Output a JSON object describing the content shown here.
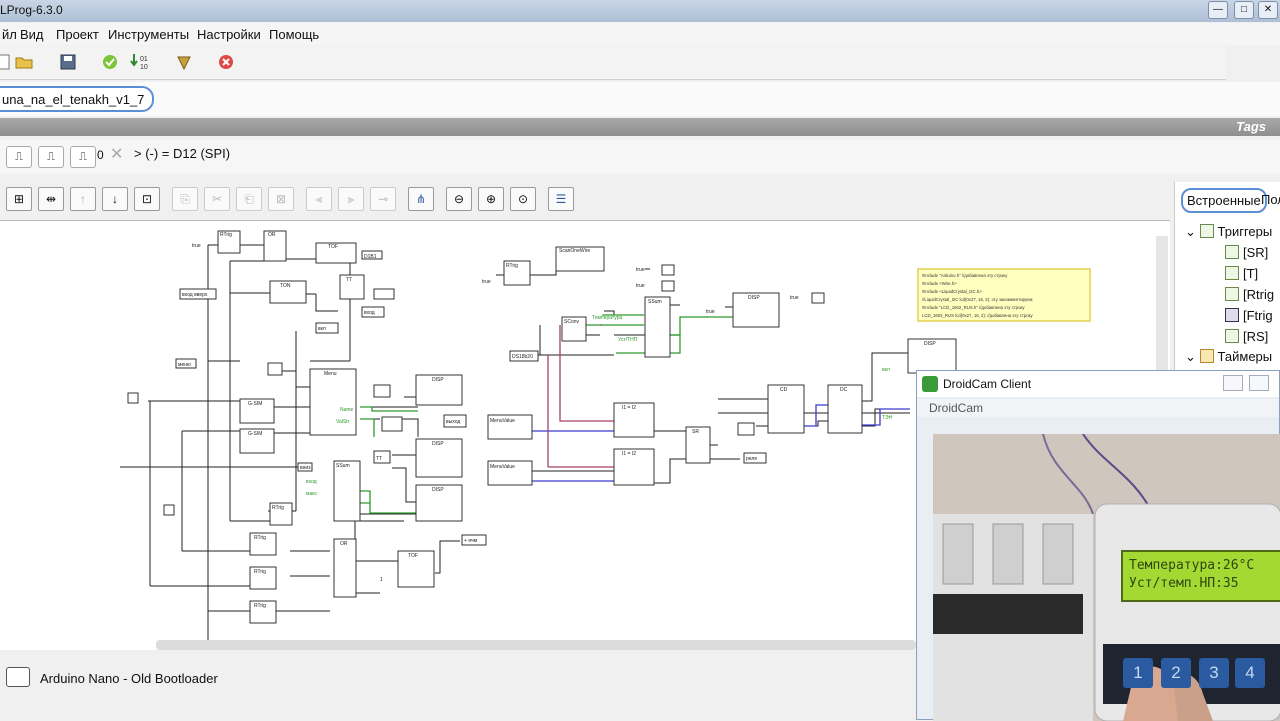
{
  "window": {
    "title": "LProg-6.3.0",
    "controls": [
      "—",
      "□",
      "✕"
    ]
  },
  "menu": [
    "йл",
    "Вид",
    "Проект",
    "Инструменты",
    "Настройки",
    "Помощь"
  ],
  "project_tab": "una_na_el_tenakh_v1_7",
  "tags_label": "Tags",
  "formula": {
    "prefix": "0",
    "text": "> (-) = D12 (SPI)"
  },
  "status_bar": {
    "board": "Arduino Nano - Old Bootloader"
  },
  "right_panel": {
    "tab_builtin": "Встроенные",
    "tab_other": "Пол",
    "tree": [
      {
        "label": "Триггеры",
        "group": true
      },
      {
        "label": "[SR]"
      },
      {
        "label": "[T]"
      },
      {
        "label": "[Rtrig"
      },
      {
        "label": "[Ftrig"
      },
      {
        "label": "[RS]"
      },
      {
        "label": "Таймеры",
        "group": true
      }
    ]
  },
  "diagram": {
    "blocks": {
      "rtrig1": "RTrig",
      "or1": "OR",
      "tof1": "TOF",
      "tt1": "TT",
      "ton": "TON",
      "menu": "Menu",
      "gsim1": "G-SIM",
      "gsim2": "G-SIM",
      "ssum1": "SSum",
      "disp1": "DISP",
      "disp2": "DISP",
      "disp3": "DISP",
      "tt2": "TT",
      "rtrig2": "RTrig",
      "rtrig3": "RTrig",
      "rtrig4": "RTrig",
      "rtrig5": "RTrig",
      "or2": "OR",
      "tof2": "TOF",
      "scan": "ScanOneWire",
      "rtrig6": "RTrig",
      "sconv": "SConv",
      "ssum2": "SSum",
      "disp4": "DISP",
      "i1": "I1 = I2",
      "i2": "I1 = I2",
      "sr": "SR",
      "cd": "CD",
      "dc": "DC",
      "disp5": "DISP",
      "mv1": "MenuValue",
      "mv2": "MenuValue"
    },
    "labels": {
      "true": "true",
      "d1": "D1B1",
      "vhod": "вход",
      "vkl": "вкл",
      "vhodsb": "вход вверх",
      "menu": "меню",
      "max": "макс",
      "vyhod": "выход",
      "tt_label": "TT",
      "one": "1",
      "plus": "+ ячм",
      "dsb": "DS18b20",
      "temp": "Температура",
      "ust": "Уст/ТНП",
      "name": "Name",
      "valstr": "ValStr",
      "mh": "M-2",
      "rele": "реле",
      "zero": "0",
      "low": "вниз",
      "vverh": "вверх",
      "ten": "ТЭН"
    },
    "comment": [
      "#include \"Arduino.h\"  //добавлена эту строку",
      "#include <Wire.h>",
      "#include <LiquidCrystal_I2C.h>",
      "//LiquidCrystal_I2C lcd(0x27, 16, 2); эту закомментируем",
      "#include \"LCD_1602_RUS.h\" //добавлена эту строку",
      "LCD_1602_RUS lcd(0x27, 16, 2); //добавлена эту строку"
    ]
  },
  "droidcam": {
    "title": "DroidCam Client",
    "menu": "DroidCam",
    "lcd_line1": "Температура:26°C",
    "lcd_line2": "Уст/темп.НП:35",
    "keys": [
      "1",
      "2",
      "3",
      "4"
    ]
  },
  "colors": {
    "accent": "#5a8fd6",
    "lcd": "#a4d832",
    "wire_green": "#2e9a2e",
    "wire_blue": "#3a3ad0",
    "wire_purple": "#a8406a",
    "comment_bg": "#ffffc0"
  }
}
